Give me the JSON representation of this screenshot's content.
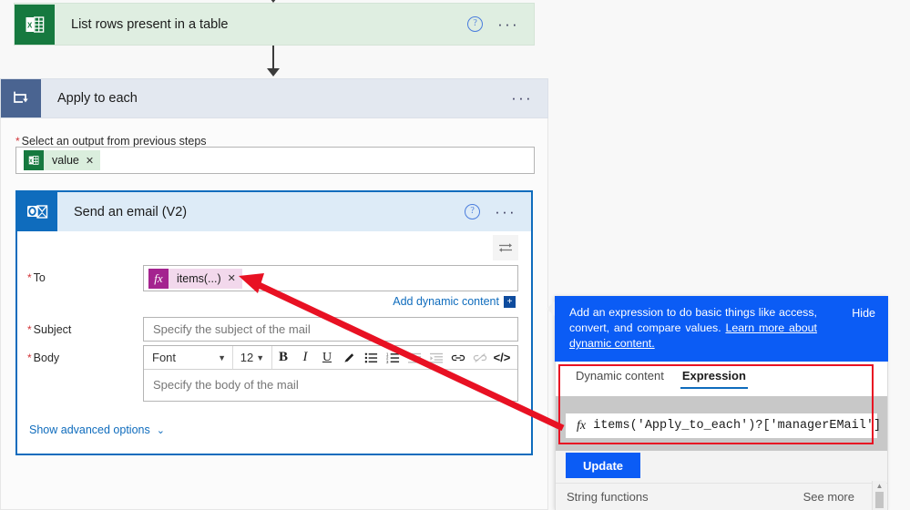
{
  "flow": {
    "excel_action": {
      "title": "List rows present in a table",
      "icon": "excel-icon",
      "help_label": "?",
      "more_label": "···",
      "header_color": "#dfeee1",
      "icon_color": "#16793f"
    },
    "apply_to_each": {
      "title": "Apply to each",
      "icon": "foreach-loop-icon",
      "more_label": "···",
      "header_color": "#e3e8f0",
      "icon_color": "#4a6491",
      "output_field": {
        "label": "Select an output from previous steps",
        "required": true,
        "chip": {
          "label": "value",
          "remove_label": "✕",
          "icon": "excel-icon",
          "color": "#daeedd"
        }
      }
    },
    "send_email": {
      "title": "Send an email (V2)",
      "icon": "outlook-icon",
      "help_label": "?",
      "more_label": "···",
      "header_color": "#ddebf7",
      "icon_color": "#0f6cbd",
      "swap_icon": "swap-arrows-icon",
      "fields": {
        "to": {
          "label": "To",
          "required": true,
          "chip": {
            "label": "items(...)",
            "remove_label": "✕",
            "icon": "fx-icon",
            "color": "#f2d8ec",
            "icon_color": "#a4238f"
          },
          "add_dynamic_content": "Add dynamic content"
        },
        "subject": {
          "label": "Subject",
          "required": true,
          "placeholder": "Specify the subject of the mail",
          "value": ""
        },
        "body": {
          "label": "Body",
          "required": true,
          "placeholder": "Specify the body of the mail",
          "value": "",
          "toolbar": {
            "font_name": "Font",
            "font_size": "12",
            "buttons": [
              {
                "name": "bold-icon",
                "glyph": "B",
                "enabled": true
              },
              {
                "name": "italic-icon",
                "glyph": "I",
                "enabled": true
              },
              {
                "name": "underline-icon",
                "glyph": "U",
                "enabled": true
              },
              {
                "name": "highlight-pen-icon",
                "glyph": "✎",
                "enabled": true
              },
              {
                "name": "bulleted-list-icon",
                "glyph": "☰",
                "enabled": true
              },
              {
                "name": "numbered-list-icon",
                "glyph": "☰",
                "enabled": true
              },
              {
                "name": "decrease-indent-icon",
                "glyph": "☰",
                "enabled": false
              },
              {
                "name": "increase-indent-icon",
                "glyph": "☰",
                "enabled": false
              },
              {
                "name": "insert-link-icon",
                "glyph": "🔗",
                "enabled": true
              },
              {
                "name": "remove-link-icon",
                "glyph": "🔗",
                "enabled": false
              },
              {
                "name": "code-view-icon",
                "glyph": "</>",
                "enabled": true
              }
            ]
          }
        }
      },
      "show_advanced_options": "Show advanced options"
    }
  },
  "expression_panel": {
    "intro_text_1": "Add an expression to do basic things like access, convert, and compare values.",
    "intro_link": "Learn more about dynamic content.",
    "hide_label": "Hide",
    "header_color": "#0b5cf5",
    "tabs": [
      {
        "label": "Dynamic content",
        "active": false
      },
      {
        "label": "Expression",
        "active": true
      }
    ],
    "expression_input": {
      "fx_label": "fx",
      "value": "items('Apply_to_each')?['managerEMail']"
    },
    "update_button": "Update",
    "function_group": "String functions",
    "see_more": "See more",
    "highlight_color": "#e81123"
  }
}
